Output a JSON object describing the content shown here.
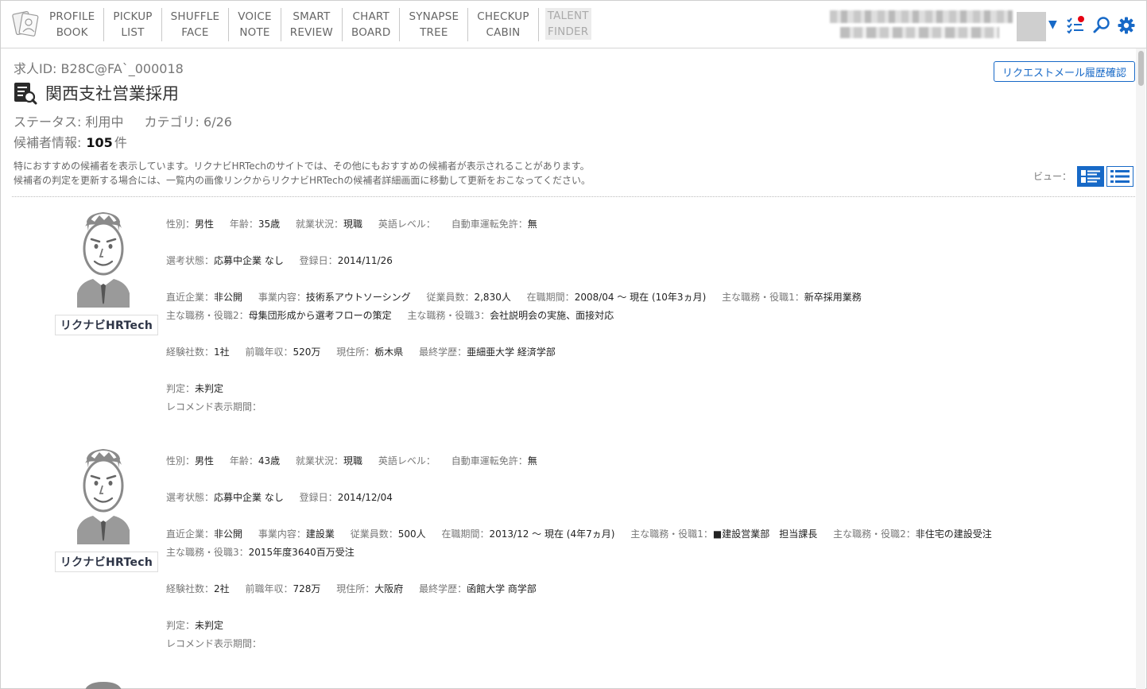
{
  "nav": [
    {
      "line1": "PROFILE",
      "line2": "BOOK"
    },
    {
      "line1": "PICKUP",
      "line2": "LIST"
    },
    {
      "line1": "SHUFFLE",
      "line2": "FACE"
    },
    {
      "line1": "VOICE",
      "line2": "NOTE"
    },
    {
      "line1": "SMART",
      "line2": "REVIEW"
    },
    {
      "line1": "CHART",
      "line2": "BOARD"
    },
    {
      "line1": "SYNAPSE",
      "line2": "TREE"
    },
    {
      "line1": "CHECKUP",
      "line2": "CABIN"
    },
    {
      "line1": "TALENT",
      "line2": "FINDER"
    }
  ],
  "job": {
    "id_label": "求人ID:",
    "id_value": "B28C@FA`_000018",
    "title": "関西支社営業採用",
    "status_label": "ステータス:",
    "status_value": "利用中",
    "category_label": "カテゴリ:",
    "category_value": "6/26",
    "cand_label": "候補者情報:",
    "cand_count": "105",
    "cand_unit": "件",
    "notice1": "特におすすめの候補者を表示しています。リクナビHRTechのサイトでは、その他にもおすすめの候補者が表示されることがあります。",
    "notice2": "候補者の判定を更新する場合には、一覧内の画像リンクからリクナビHRTechの候補者詳細画面に移動して更新をおこなってください。",
    "request_button": "リクエストメール履歴確認",
    "view_label": "ビュー："
  },
  "brand": {
    "logo_text": "リクナビHRTech"
  },
  "colors": {
    "accent": "#1769c7",
    "notification": "#e60012"
  },
  "candidates": [
    {
      "gender_k": "性別：",
      "gender_v": "男性",
      "age_k": "年齢：",
      "age_v": "35歳",
      "work_k": "就業状況：",
      "work_v": "現職",
      "eng_k": "英語レベル：",
      "eng_v": "",
      "car_k": "自動車運転免許：",
      "car_v": "無",
      "sel_k": "選考状態：",
      "sel_v": "応募中企業 なし",
      "reg_k": "登録日：",
      "reg_v": "2014/11/26",
      "comp_k": "直近企業：",
      "comp_v": "非公開",
      "biz_k": "事業内容：",
      "biz_v": "技術系アウトソーシング",
      "emp_k": "従業員数：",
      "emp_v": "2,830人",
      "tenure_k": "在職期間：",
      "tenure_v": "2008/04 ～ 現在 (10年3ヵ月)",
      "role1_k": "主な職務・役職1：",
      "role1_v": "新卒採用業務",
      "role2_k": "主な職務・役職2：",
      "role2_v": "母集団形成から選考フローの策定",
      "role3_k": "主な職務・役職3：",
      "role3_v": "会社説明会の実施、面接対応",
      "exp_k": "経験社数：",
      "exp_v": "1社",
      "sal_k": "前職年収：",
      "sal_v": "520万",
      "addr_k": "現住所：",
      "addr_v": "栃木県",
      "edu_k": "最終学歴：",
      "edu_v": "亜細亜大学 経済学部",
      "judge_k": "判定：",
      "judge_v": "未判定",
      "rec_k": "レコメンド表示期間：",
      "rec_v": ""
    },
    {
      "gender_k": "性別：",
      "gender_v": "男性",
      "age_k": "年齢：",
      "age_v": "43歳",
      "work_k": "就業状況：",
      "work_v": "現職",
      "eng_k": "英語レベル：",
      "eng_v": "",
      "car_k": "自動車運転免許：",
      "car_v": "無",
      "sel_k": "選考状態：",
      "sel_v": "応募中企業 なし",
      "reg_k": "登録日：",
      "reg_v": "2014/12/04",
      "comp_k": "直近企業：",
      "comp_v": "非公開",
      "biz_k": "事業内容：",
      "biz_v": "建設業",
      "emp_k": "従業員数：",
      "emp_v": "500人",
      "tenure_k": "在職期間：",
      "tenure_v": "2013/12 ～ 現在 (4年7ヵ月)",
      "role1_k": "主な職務・役職1：",
      "role1_v": "■建設営業部　担当課長",
      "role2_k": "主な職務・役職2：",
      "role2_v": "非住宅の建設受注",
      "role3_k": "主な職務・役職3：",
      "role3_v": "2015年度3640百万受注",
      "exp_k": "経験社数：",
      "exp_v": "2社",
      "sal_k": "前職年収：",
      "sal_v": "728万",
      "addr_k": "現住所：",
      "addr_v": "大阪府",
      "edu_k": "最終学歴：",
      "edu_v": "函館大学 商学部",
      "judge_k": "判定：",
      "judge_v": "未判定",
      "rec_k": "レコメンド表示期間：",
      "rec_v": ""
    }
  ]
}
